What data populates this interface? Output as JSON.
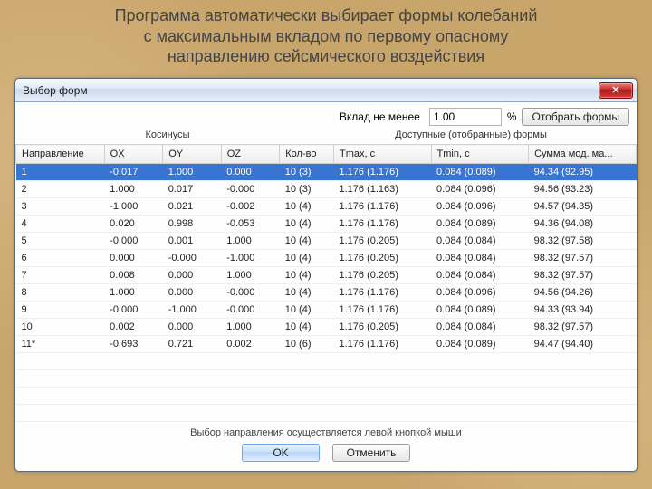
{
  "caption": {
    "line1": "Программа автоматически выбирает формы колебаний",
    "line2": "с максимальным вкладом по первому опасному",
    "line3": "направлению сейсмического воздействия"
  },
  "window": {
    "title": "Выбор форм",
    "close_icon": "✕",
    "toolbar": {
      "label": "Вклад не менее",
      "value": "1.00",
      "unit": "%",
      "select_btn": "Отобрать формы"
    },
    "group_headers": {
      "left": "Косинусы",
      "right": "Доступные (отобранные) формы"
    },
    "columns": {
      "dir": "Направление",
      "ox": "OX",
      "oy": "OY",
      "oz": "OZ",
      "count": "Кол-во",
      "tmax": "Tmax, c",
      "tmin": "Tmin, c",
      "sum": "Сумма мод. ма..."
    },
    "rows": [
      {
        "dir": "1",
        "ox": "-0.017",
        "oy": "1.000",
        "oz": "0.000",
        "count": "10 (3)",
        "tmax": "1.176 (1.176)",
        "tmin": "0.084 (0.089)",
        "sum": "94.34 (92.95)",
        "selected": true
      },
      {
        "dir": "2",
        "ox": "1.000",
        "oy": "0.017",
        "oz": "-0.000",
        "count": "10 (3)",
        "tmax": "1.176 (1.163)",
        "tmin": "0.084 (0.096)",
        "sum": "94.56 (93.23)"
      },
      {
        "dir": "3",
        "ox": "-1.000",
        "oy": "0.021",
        "oz": "-0.002",
        "count": "10 (4)",
        "tmax": "1.176 (1.176)",
        "tmin": "0.084 (0.096)",
        "sum": "94.57 (94.35)"
      },
      {
        "dir": "4",
        "ox": "0.020",
        "oy": "0.998",
        "oz": "-0.053",
        "count": "10 (4)",
        "tmax": "1.176 (1.176)",
        "tmin": "0.084 (0.089)",
        "sum": "94.36 (94.08)"
      },
      {
        "dir": "5",
        "ox": "-0.000",
        "oy": "0.001",
        "oz": "1.000",
        "count": "10 (4)",
        "tmax": "1.176 (0.205)",
        "tmin": "0.084 (0.084)",
        "sum": "98.32 (97.58)"
      },
      {
        "dir": "6",
        "ox": "0.000",
        "oy": "-0.000",
        "oz": "-1.000",
        "count": "10 (4)",
        "tmax": "1.176 (0.205)",
        "tmin": "0.084 (0.084)",
        "sum": "98.32 (97.57)"
      },
      {
        "dir": "7",
        "ox": "0.008",
        "oy": "0.000",
        "oz": "1.000",
        "count": "10 (4)",
        "tmax": "1.176 (0.205)",
        "tmin": "0.084 (0.084)",
        "sum": "98.32 (97.57)"
      },
      {
        "dir": "8",
        "ox": "1.000",
        "oy": "0.000",
        "oz": "-0.000",
        "count": "10 (4)",
        "tmax": "1.176 (1.176)",
        "tmin": "0.084 (0.096)",
        "sum": "94.56 (94.26)"
      },
      {
        "dir": "9",
        "ox": "-0.000",
        "oy": "-1.000",
        "oz": "-0.000",
        "count": "10 (4)",
        "tmax": "1.176 (1.176)",
        "tmin": "0.084 (0.089)",
        "sum": "94.33 (93.94)"
      },
      {
        "dir": "10",
        "ox": "0.002",
        "oy": "0.000",
        "oz": "1.000",
        "count": "10 (4)",
        "tmax": "1.176 (0.205)",
        "tmin": "0.084 (0.084)",
        "sum": "98.32 (97.57)"
      },
      {
        "dir": "11*",
        "ox": "-0.693",
        "oy": "0.721",
        "oz": "0.002",
        "count": "10 (6)",
        "tmax": "1.176 (1.176)",
        "tmin": "0.084 (0.089)",
        "sum": "94.47 (94.40)"
      }
    ],
    "hint": "Выбор направления осуществляется левой кнопкой мыши",
    "ok": "OK",
    "cancel": "Отменить"
  }
}
